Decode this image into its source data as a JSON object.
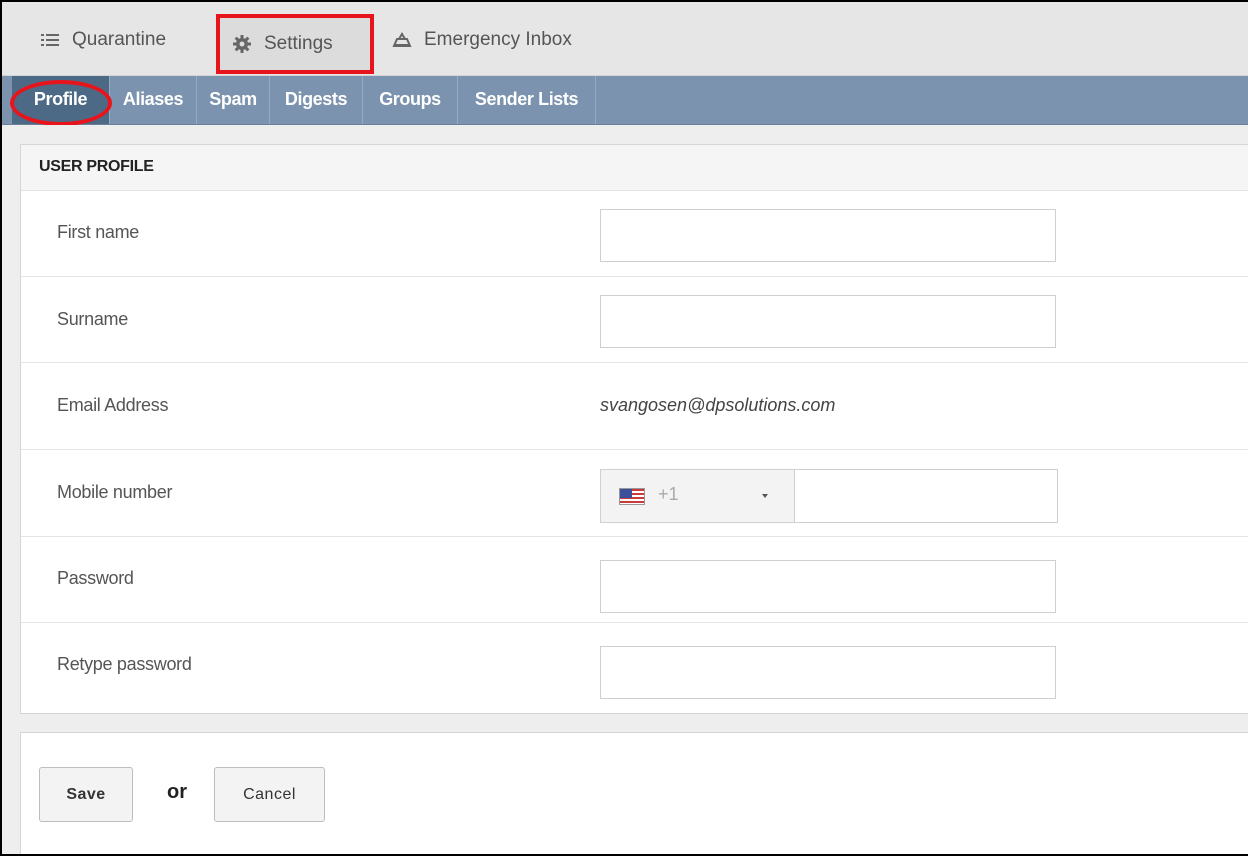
{
  "topnav": {
    "quarantine_label": "Quarantine",
    "settings_label": "Settings",
    "emergency_label": "Emergency Inbox"
  },
  "subnav": {
    "tabs": [
      {
        "label": "Profile",
        "active": true
      },
      {
        "label": "Aliases"
      },
      {
        "label": "Spam"
      },
      {
        "label": "Digests"
      },
      {
        "label": "Groups"
      },
      {
        "label": "Sender Lists"
      }
    ]
  },
  "panel": {
    "title": "USER PROFILE",
    "fields": [
      {
        "label": "First name",
        "value": ""
      },
      {
        "label": "Surname",
        "value": ""
      },
      {
        "label": "Email Address",
        "value": "svangosen@dpsolutions.com"
      },
      {
        "label": "Mobile number",
        "dial_code": "+1",
        "value": ""
      },
      {
        "label": "Password",
        "value": ""
      },
      {
        "label": "Retype password",
        "value": ""
      }
    ]
  },
  "actions": {
    "save_label": "Save",
    "or_text": "or",
    "cancel_label": "Cancel"
  },
  "colors": {
    "subnav_bg": "#7b93ae",
    "active_tab_bg": "#4c6a86",
    "highlight": "#e8141c"
  },
  "icons": {
    "quarantine": "list-icon",
    "settings": "gear-icon",
    "emergency": "inbox-icon",
    "country": "us-flag-icon"
  }
}
